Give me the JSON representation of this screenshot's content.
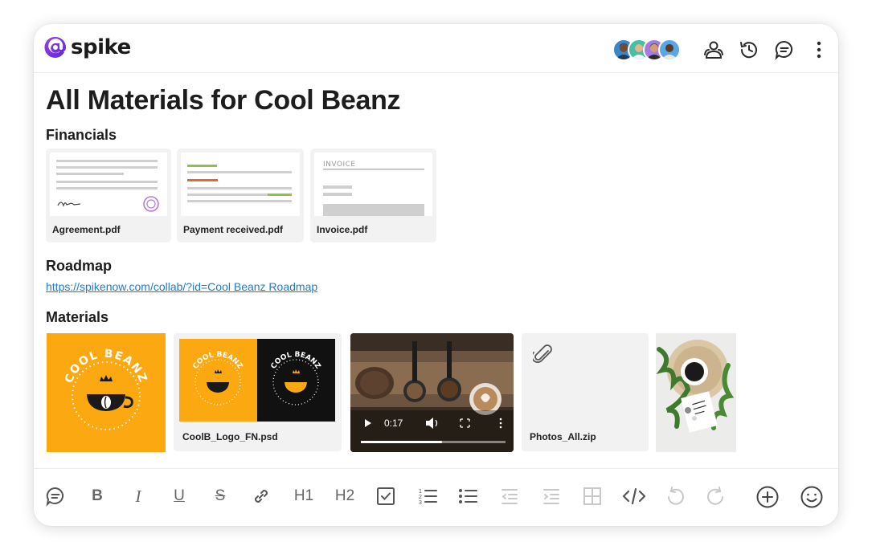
{
  "app": {
    "logo_text": "spike"
  },
  "header": {
    "avatars": [
      {
        "name": "avatar-1",
        "color": "#3d86c6",
        "skin": "#7a4a2e"
      },
      {
        "name": "avatar-2",
        "color": "#45c0a4",
        "skin": "#e7b48e"
      },
      {
        "name": "avatar-3",
        "color": "#a57be0",
        "skin": "#d59c74"
      },
      {
        "name": "avatar-4",
        "color": "#5aa7e8",
        "skin": "#5b3a26"
      }
    ],
    "icons": [
      "people-icon",
      "history-icon",
      "comment-icon",
      "more-icon"
    ]
  },
  "page": {
    "title": "All Materials for Cool Beanz"
  },
  "financials": {
    "title": "Financials",
    "files": [
      {
        "name": "Agreement.pdf"
      },
      {
        "name": "Payment received.pdf"
      },
      {
        "name": "Invoice.pdf",
        "thumb_heading": "INVOICE"
      }
    ]
  },
  "roadmap": {
    "title": "Roadmap",
    "link": "https://spikenow.com/collab/?id=Cool Beanz Roadmap"
  },
  "materials": {
    "title": "Materials",
    "logo_text": "COOL BEANZ",
    "psd_name": "CoolB_Logo_FN.psd",
    "video_time": "0:17",
    "video_progress": 0.56,
    "zip_name": "Photos_All.zip"
  },
  "toolbar": {
    "h1": "H1",
    "h2": "H2",
    "b": "B",
    "i": "I",
    "u": "U",
    "s": "S"
  },
  "colors": {
    "brand_purple": "#7b2fd6",
    "link_blue": "#1f7bd4",
    "orange": "#fca911",
    "green_line": "#8bc34a",
    "orange_line": "#e8682a"
  }
}
